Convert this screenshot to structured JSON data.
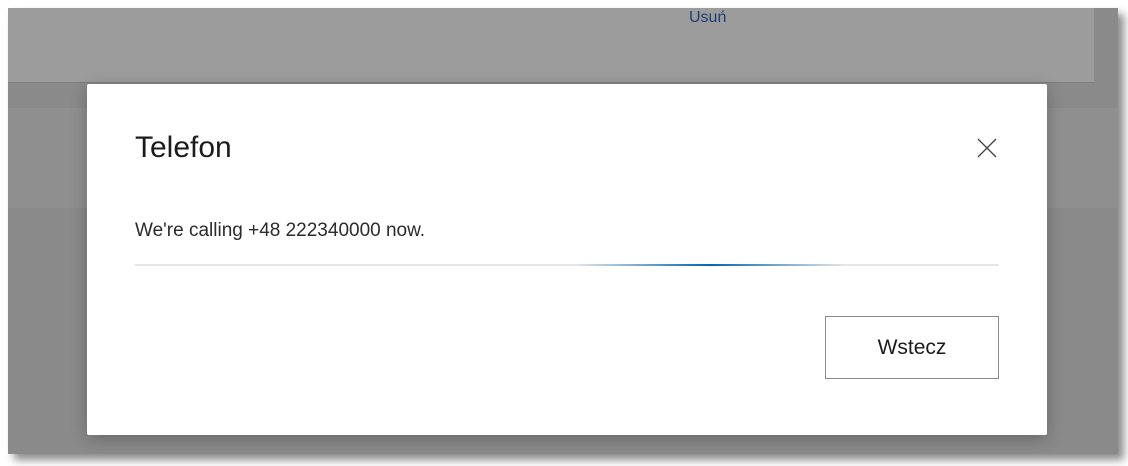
{
  "background": {
    "remove_link": "Usuń"
  },
  "dialog": {
    "title": "Telefon",
    "message": "We're calling +48 222340000 now.",
    "back_button": "Wstecz",
    "close_icon": "close-icon"
  },
  "colors": {
    "accent": "#0067b8",
    "backdrop": "#8a8a8a",
    "link": "#1d3f73"
  }
}
